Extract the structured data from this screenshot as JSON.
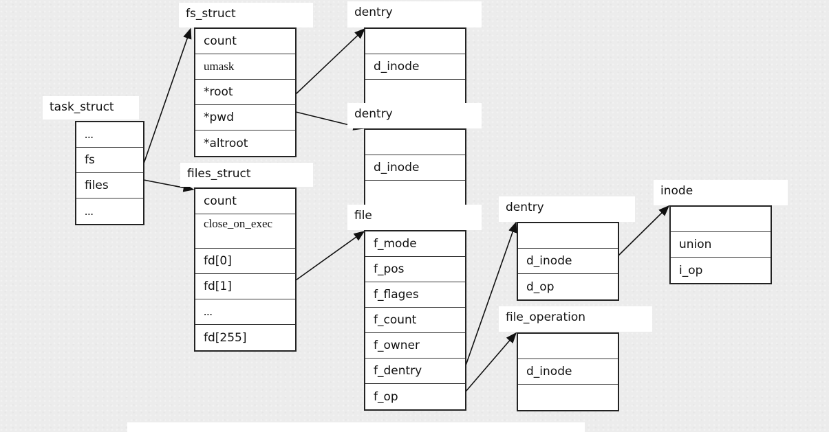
{
  "structs": [
    {
      "id": "task_struct",
      "title": "task_struct",
      "fields": [
        "...",
        "fs",
        "files",
        "..."
      ]
    },
    {
      "id": "fs_struct",
      "title": "fs_struct",
      "fields": [
        "count",
        "umask",
        "*root",
        "*pwd",
        "*altroot"
      ]
    },
    {
      "id": "files_struct",
      "title": "files_struct",
      "fields": [
        "count",
        "close_on_exec",
        "fd[0]",
        "fd[1]",
        "...",
        "fd[255]"
      ]
    },
    {
      "id": "dentry_root",
      "title": "dentry",
      "fields": [
        "",
        "d_inode",
        ""
      ]
    },
    {
      "id": "dentry_pwd",
      "title": "dentry",
      "fields": [
        "",
        "d_inode",
        ""
      ]
    },
    {
      "id": "file",
      "title": "file",
      "fields": [
        "f_mode",
        "f_pos",
        "f_flages",
        "f_count",
        "f_owner",
        "f_dentry",
        "f_op"
      ]
    },
    {
      "id": "dentry_file",
      "title": "dentry",
      "fields": [
        "",
        "d_inode",
        "d_op"
      ]
    },
    {
      "id": "file_operation",
      "title": "file_operation",
      "fields": [
        "",
        "d_inode",
        ""
      ]
    },
    {
      "id": "inode",
      "title": "inode",
      "fields": [
        "",
        "union",
        "i_op"
      ]
    }
  ],
  "arrows": [
    {
      "from": "task_struct.fs",
      "to": "fs_struct"
    },
    {
      "from": "task_struct.files",
      "to": "files_struct"
    },
    {
      "from": "fs_struct.*root",
      "to": "dentry_root"
    },
    {
      "from": "fs_struct.*pwd",
      "to": "dentry_pwd"
    },
    {
      "from": "files_struct.fd[1]",
      "to": "file"
    },
    {
      "from": "file.f_dentry",
      "to": "dentry_file"
    },
    {
      "from": "file.f_op",
      "to": "file_operation"
    },
    {
      "from": "dentry_file.d_inode",
      "to": "inode"
    }
  ]
}
